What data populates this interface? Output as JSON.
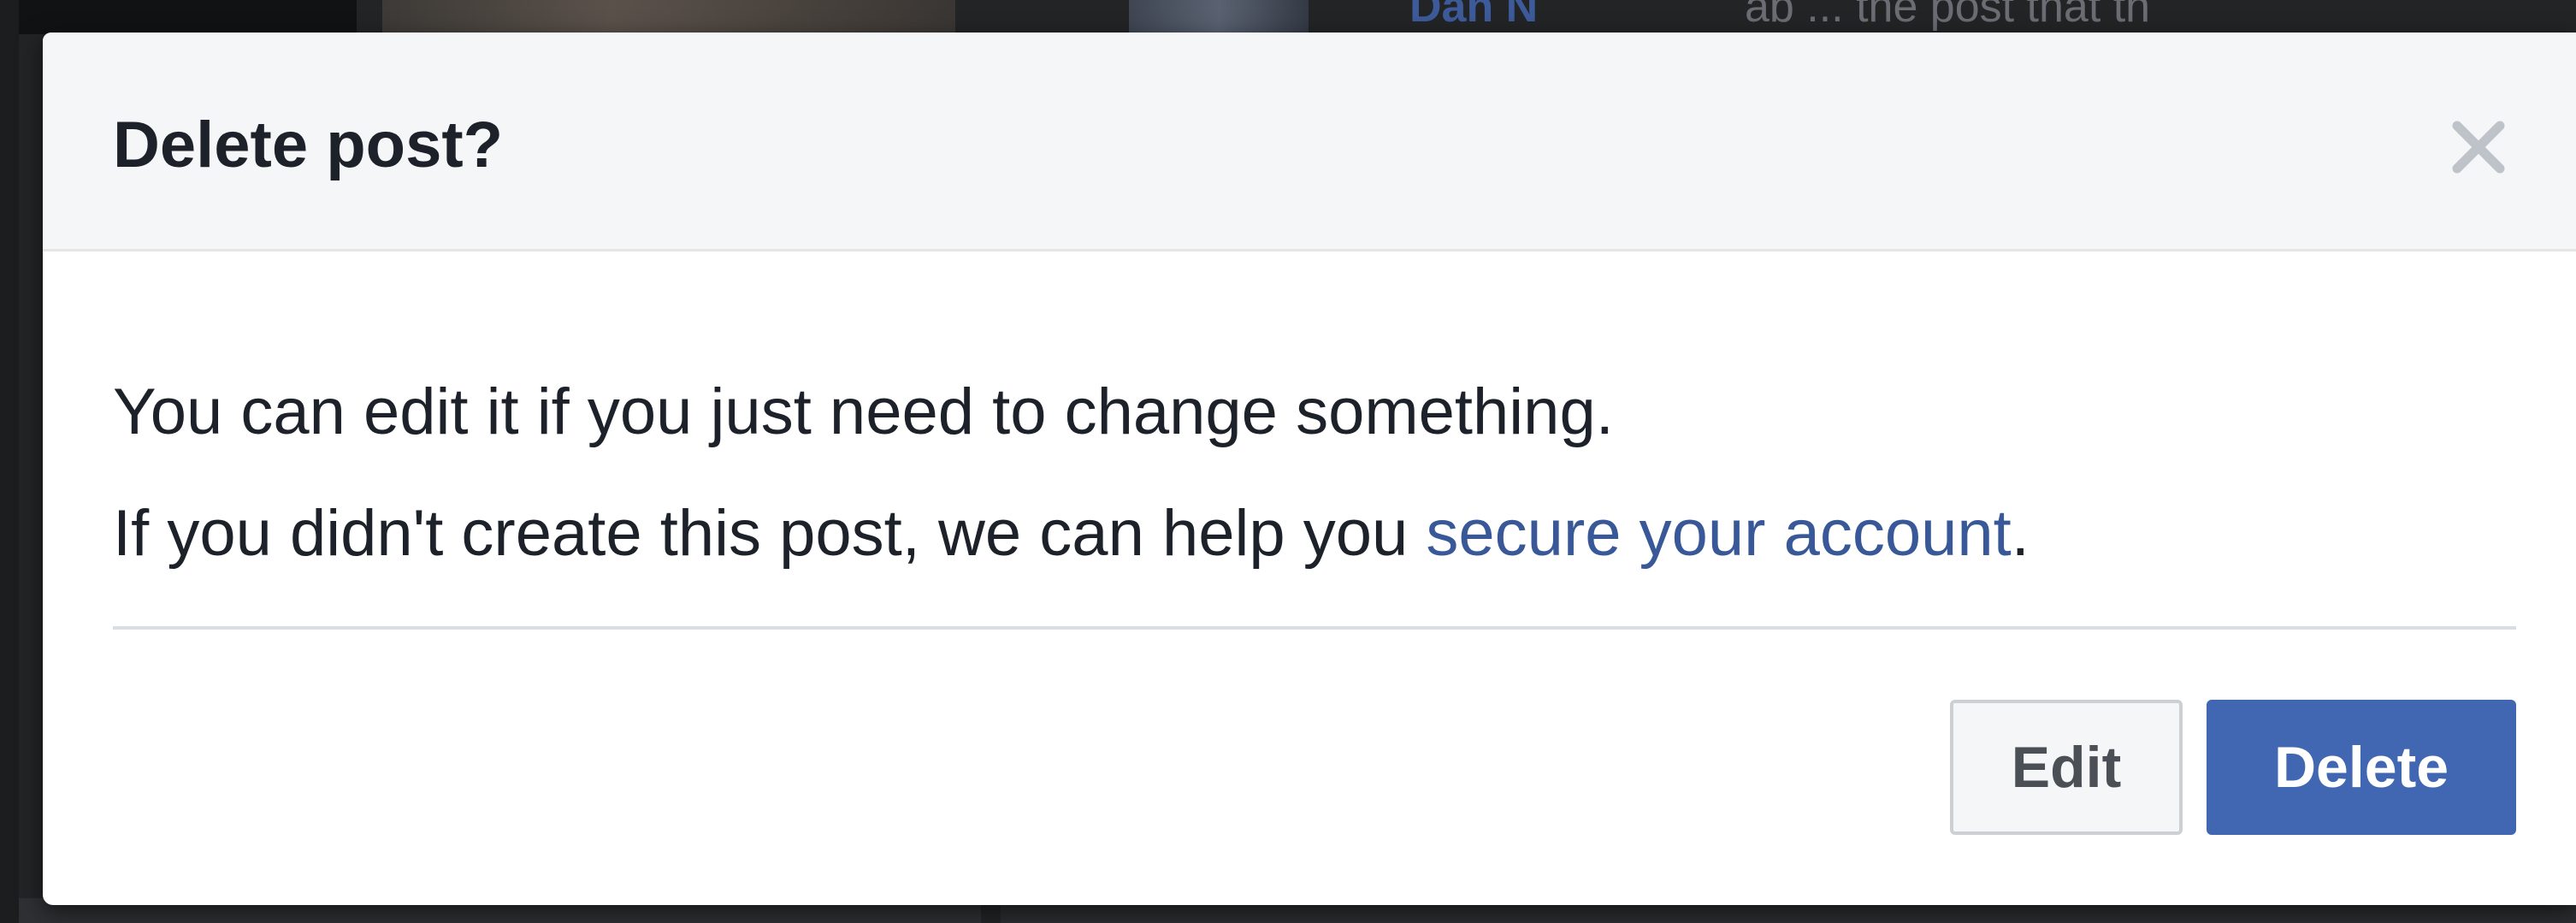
{
  "background": {
    "author_link": "Dan N",
    "post_text": "ab ... the post that th"
  },
  "dialog": {
    "title": "Delete post?",
    "close_icon": "close-icon",
    "message_line_1": "You can edit it if you just need to change something.",
    "message_line_2_prefix": "If you didn't create this post, we can help you ",
    "message_link": "secure your account",
    "message_line_2_suffix": ".",
    "edit_label": "Edit",
    "delete_label": "Delete"
  },
  "colors": {
    "primary": "#4267b2",
    "link": "#385898",
    "header_bg": "#f5f6f7",
    "text": "#1d2129"
  }
}
